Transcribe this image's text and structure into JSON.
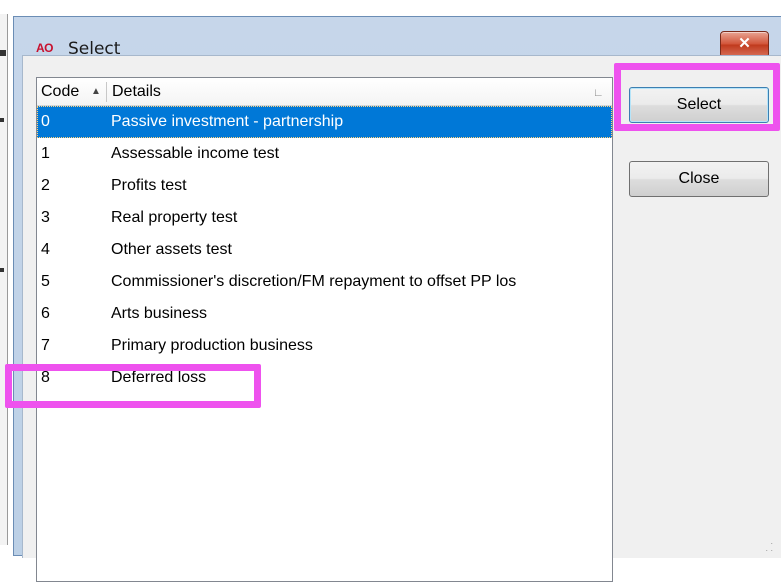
{
  "window": {
    "title": "Select",
    "app_icon": "AO"
  },
  "listview": {
    "columns": {
      "code": "Code",
      "details": "Details"
    },
    "selected_code": "0",
    "rows": [
      {
        "code": "0",
        "details": "Passive investment - partnership"
      },
      {
        "code": "1",
        "details": "Assessable income test"
      },
      {
        "code": "2",
        "details": "Profits test"
      },
      {
        "code": "3",
        "details": "Real property test"
      },
      {
        "code": "4",
        "details": "Other assets test"
      },
      {
        "code": "5",
        "details": "Commissioner's discretion/FM repayment to offset PP los"
      },
      {
        "code": "6",
        "details": "Arts business"
      },
      {
        "code": "7",
        "details": "Primary production business"
      },
      {
        "code": "8",
        "details": "Deferred loss"
      }
    ]
  },
  "buttons": {
    "select": "Select",
    "close": "Close",
    "window_close": "✕"
  },
  "annotation_color": "#ee52ee"
}
